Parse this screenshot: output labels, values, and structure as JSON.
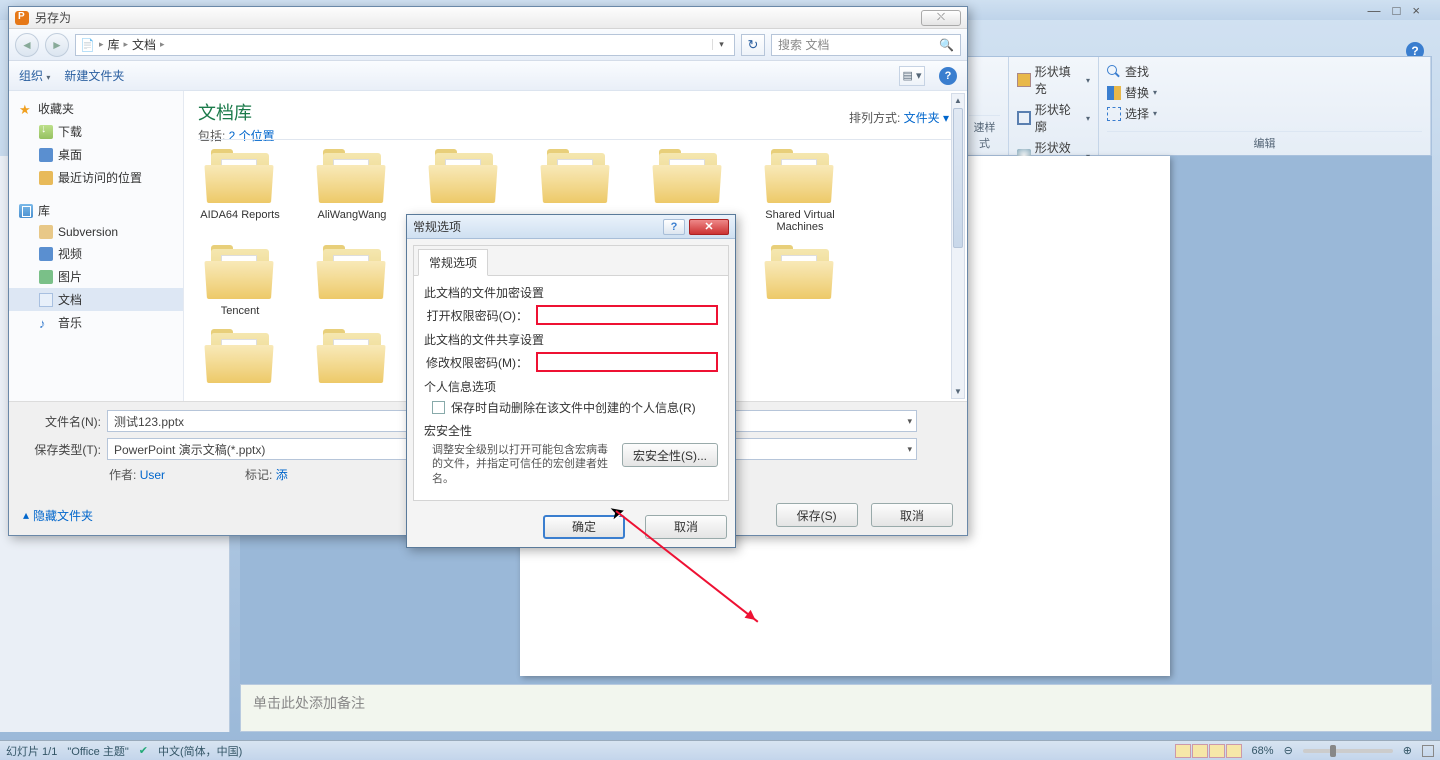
{
  "app": {
    "win_min": "—",
    "win_max": "□",
    "win_close": "×",
    "help": "?"
  },
  "ribbon": {
    "fill": "形状填充",
    "outline": "形状轮廓",
    "effect": "形状效果",
    "styles_label": "速样式",
    "find": "查找",
    "replace": "替换",
    "select": "选择",
    "edit_label": "编辑"
  },
  "notes_placeholder": "单击此处添加备注",
  "status": {
    "slide": "幻灯片 1/1",
    "theme": "\"Office 主题\"",
    "lang": "中文(简体，中国)",
    "zoom": "68%"
  },
  "saveas": {
    "title": "另存为",
    "close_glyph": "⤬",
    "breadcrumb": {
      "icon_alt": "doc-icon",
      "p1": "库",
      "p2": "文档"
    },
    "refresh_glyph": "↻",
    "search_placeholder": "搜索 文档",
    "toolbar": {
      "organize": "组织",
      "newfolder": "新建文件夹"
    },
    "tree": {
      "fav": "收藏夹",
      "dl": "下载",
      "desk": "桌面",
      "recent": "最近访问的位置",
      "lib": "库",
      "svn": "Subversion",
      "vid": "视频",
      "pic": "图片",
      "doc": "文档",
      "mus": "音乐"
    },
    "libhead": "文档库",
    "libsub_prefix": "包括: ",
    "libsub_link": "2 个位置",
    "sort_label": "排列方式: ",
    "sort_value": "文件夹",
    "folders": [
      "AIDA64 Reports",
      "AliWangWang",
      "",
      "",
      "",
      "Shared Virtual Machines",
      "Tencent",
      "",
      "",
      "",
      "",
      "",
      "",
      ""
    ],
    "filename_label": "文件名(N):",
    "filename_value": "测试123.pptx",
    "filetype_label": "保存类型(T):",
    "filetype_value": "PowerPoint 演示文稿(*.pptx)",
    "author_label": "作者:",
    "author_value": "User",
    "tags_label": "标记:",
    "tags_value": "添",
    "hide_folders": "隐藏文件夹",
    "save_btn": "保存(S)",
    "cancel_btn": "取消"
  },
  "options": {
    "title": "常规选项",
    "tab": "常规选项",
    "sect_encrypt": "此文档的文件加密设置",
    "open_pwd": "打开权限密码(O)：",
    "sect_share": "此文档的文件共享设置",
    "mod_pwd": "修改权限密码(M)：",
    "sect_personal": "个人信息选项",
    "cb_personal": "保存时自动删除在该文件中创建的个人信息(R)",
    "sect_macro": "宏安全性",
    "macro_text": "调整安全级别以打开可能包含宏病毒的文件，并指定可信任的宏创建者姓名。",
    "macro_btn": "宏安全性(S)...",
    "ok": "确定",
    "cancel": "取消"
  }
}
